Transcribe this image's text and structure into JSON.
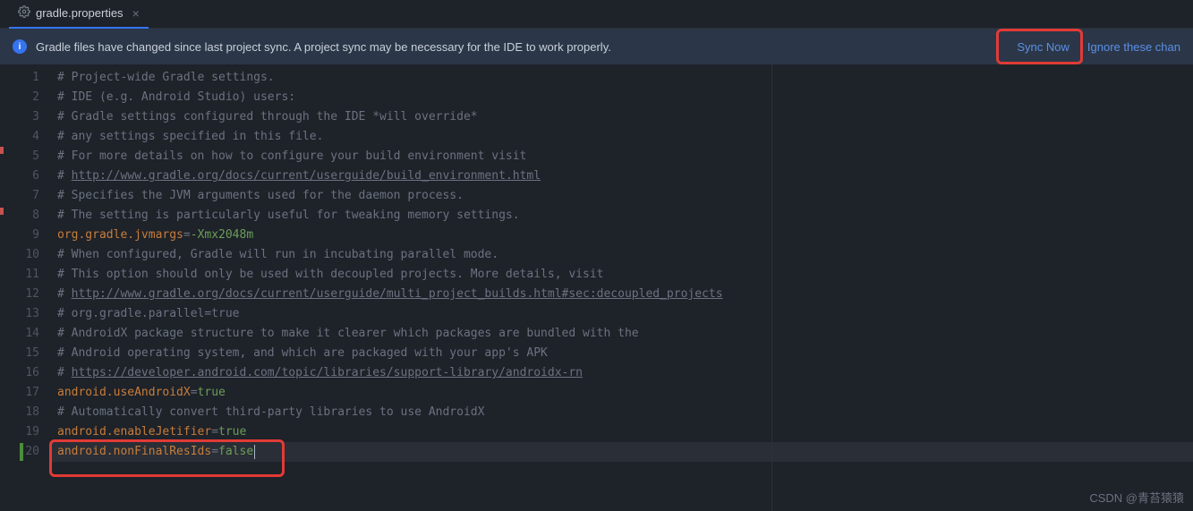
{
  "tab": {
    "filename": "gradle.properties",
    "close_glyph": "×"
  },
  "notification": {
    "message": "Gradle files have changed since last project sync. A project sync may be necessary for the IDE to work properly.",
    "sync_now": "Sync Now",
    "ignore": "Ignore these chan"
  },
  "lines": [
    {
      "n": 1,
      "type": "comment",
      "text": "# Project-wide Gradle settings."
    },
    {
      "n": 2,
      "type": "comment",
      "text": "# IDE (e.g. Android Studio) users:"
    },
    {
      "n": 3,
      "type": "comment",
      "text": "# Gradle settings configured through the IDE *will override*"
    },
    {
      "n": 4,
      "type": "comment",
      "text": "# any settings specified in this file."
    },
    {
      "n": 5,
      "type": "comment",
      "text": "# For more details on how to configure your build environment visit"
    },
    {
      "n": 6,
      "type": "commentlink",
      "prefix": "# ",
      "link": "http://www.gradle.org/docs/current/userguide/build_environment.html"
    },
    {
      "n": 7,
      "type": "comment",
      "text": "# Specifies the JVM arguments used for the daemon process."
    },
    {
      "n": 8,
      "type": "comment",
      "text": "# The setting is particularly useful for tweaking memory settings."
    },
    {
      "n": 9,
      "type": "prop",
      "key": "org.gradle.jvmargs",
      "val": "-Xmx2048m"
    },
    {
      "n": 10,
      "type": "comment",
      "text": "# When configured, Gradle will run in incubating parallel mode."
    },
    {
      "n": 11,
      "type": "comment",
      "text": "# This option should only be used with decoupled projects. More details, visit"
    },
    {
      "n": 12,
      "type": "commentlink",
      "prefix": "# ",
      "link": "http://www.gradle.org/docs/current/userguide/multi_project_builds.html#sec:decoupled_projects"
    },
    {
      "n": 13,
      "type": "comment",
      "text": "# org.gradle.parallel=true"
    },
    {
      "n": 14,
      "type": "comment",
      "text": "# AndroidX package structure to make it clearer which packages are bundled with the"
    },
    {
      "n": 15,
      "type": "comment",
      "text": "# Android operating system, and which are packaged with your app's APK"
    },
    {
      "n": 16,
      "type": "commentlink",
      "prefix": "# ",
      "link": "https://developer.android.com/topic/libraries/support-library/androidx-rn"
    },
    {
      "n": 17,
      "type": "prop",
      "key": "android.useAndroidX",
      "val": "true"
    },
    {
      "n": 18,
      "type": "comment",
      "text": "# Automatically convert third-party libraries to use AndroidX"
    },
    {
      "n": 19,
      "type": "prop",
      "key": "android.enableJetifier",
      "val": "true"
    },
    {
      "n": 20,
      "type": "prop",
      "key": "android.nonFinalResIds",
      "val": "false",
      "cursor": true
    }
  ],
  "watermark": "CSDN @青苔猿猿"
}
